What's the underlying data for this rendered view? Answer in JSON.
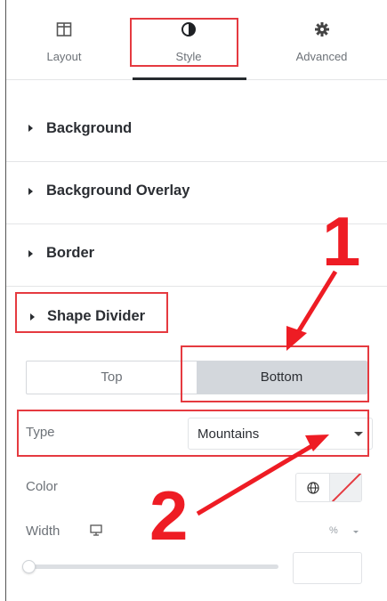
{
  "tabs": [
    {
      "label": "Layout",
      "icon": "layout-columns-icon"
    },
    {
      "label": "Style",
      "icon": "half-circle-style-icon",
      "active": true
    },
    {
      "label": "Advanced",
      "icon": "gear-icon"
    }
  ],
  "sections": {
    "background": "Background",
    "background_overlay": "Background Overlay",
    "border": "Border",
    "shape_divider": "Shape Divider"
  },
  "shape_divider": {
    "switch": {
      "top": "Top",
      "bottom": "Bottom",
      "selected": "Bottom"
    },
    "type": {
      "label": "Type",
      "value": "Mountains"
    },
    "color": {
      "label": "Color",
      "icon": "globe-icon"
    },
    "width": {
      "label": "Width",
      "device_icon": "desktop-icon",
      "unit": "%"
    }
  },
  "annotations": {
    "step1": "1",
    "step2": "2",
    "color": "#ee1c24"
  },
  "colors": {
    "highlight": "#e53a40",
    "active_segment": "#d3d7dc",
    "text": "#2b2e33"
  }
}
